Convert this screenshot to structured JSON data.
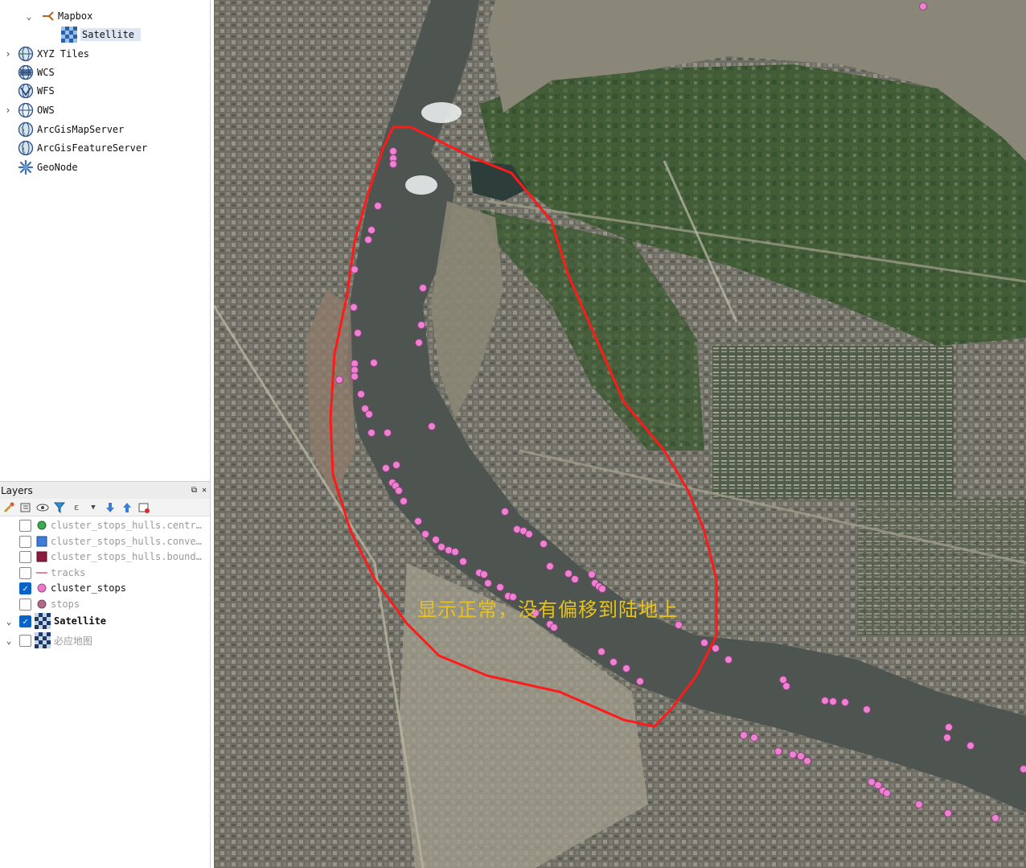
{
  "browser": {
    "mapbox": {
      "label": "Mapbox"
    },
    "satellite": {
      "label": "Satellite"
    },
    "items": [
      {
        "label": "XYZ Tiles",
        "icon": "globe-icon",
        "expandable": true
      },
      {
        "label": "WCS",
        "icon": "wcs-icon",
        "expandable": false
      },
      {
        "label": "WFS",
        "icon": "wfs-icon",
        "expandable": false
      },
      {
        "label": "OWS",
        "icon": "ows-icon",
        "expandable": true
      },
      {
        "label": "ArcGisMapServer",
        "icon": "arcgis-icon",
        "expandable": false
      },
      {
        "label": "ArcGisFeatureServer",
        "icon": "arcgis-icon",
        "expandable": false
      },
      {
        "label": "GeoNode",
        "icon": "geonode-icon",
        "expandable": false
      }
    ]
  },
  "layers_panel": {
    "title": "Layers",
    "layers": [
      {
        "name": "cluster_stops_hulls.centr…",
        "checked": false,
        "symbol": "point",
        "color": "#3daa4f"
      },
      {
        "name": "cluster_stops_hulls.conve…",
        "checked": false,
        "symbol": "polygon",
        "color": "#3b7dd8"
      },
      {
        "name": "cluster_stops_hulls.bound…",
        "checked": false,
        "symbol": "polygon",
        "color": "#8b1b3c"
      },
      {
        "name": "tracks",
        "checked": false,
        "symbol": "line",
        "color": "#e07a8c"
      },
      {
        "name": "cluster_stops",
        "checked": true,
        "symbol": "point",
        "color": "#e87ac9"
      },
      {
        "name": "stops",
        "checked": false,
        "symbol": "point",
        "color": "#b06a86"
      },
      {
        "name": "Satellite",
        "checked": true,
        "symbol": "raster"
      },
      {
        "name": "必应地图",
        "checked": false,
        "symbol": "raster"
      }
    ]
  },
  "map": {
    "annotation": "显示正常，没有偏移到陆地上",
    "annotation_color": "#e6c21e",
    "outline_color": "#ff1a1a",
    "point_color": "#ec82d0"
  }
}
